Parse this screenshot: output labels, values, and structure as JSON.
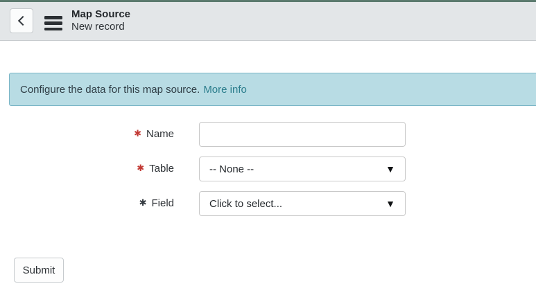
{
  "header": {
    "title": "Map Source",
    "subtitle": "New record"
  },
  "banner": {
    "message": "Configure the data for this map source.",
    "link_label": "More info"
  },
  "form": {
    "fields": [
      {
        "label": "Name",
        "type": "text",
        "value": "",
        "required": true,
        "required_state": "mandatory-empty"
      },
      {
        "label": "Table",
        "type": "select",
        "value": "-- None --",
        "required": true,
        "required_state": "mandatory-empty"
      },
      {
        "label": "Field",
        "type": "select",
        "value": "Click to select...",
        "required": true,
        "required_state": "mandatory-readonly"
      }
    ],
    "submit_label": "Submit"
  },
  "icons": {
    "dropdown": "▼",
    "required": "✱"
  },
  "colors": {
    "accent": "#5b7a6e",
    "header-bg": "#e3e6e8",
    "banner-bg": "#b8dce4",
    "banner-border": "#7ab5c6",
    "link-teal": "#2b7d8c",
    "required-red": "#c23934",
    "required-gray": "#343a40"
  }
}
